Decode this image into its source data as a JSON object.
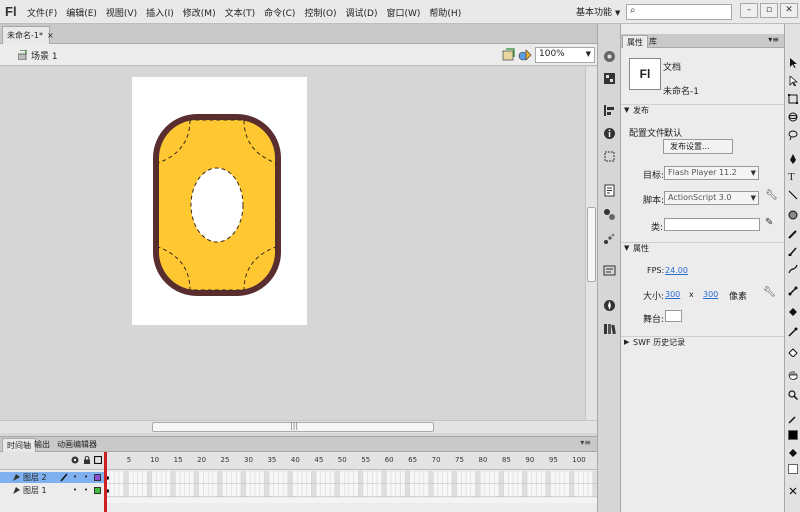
{
  "app": {
    "logo": "Fl"
  },
  "menu": [
    "文件(F)",
    "编辑(E)",
    "视图(V)",
    "插入(I)",
    "修改(M)",
    "文本(T)",
    "命令(C)",
    "控制(O)",
    "调试(D)",
    "窗口(W)",
    "帮助(H)"
  ],
  "workspace": {
    "label": "基本功能"
  },
  "window_controls": {
    "minimize": "–",
    "restore": "▫",
    "close": "✕"
  },
  "document": {
    "tab_name": "未命名-1*",
    "tab_close": "×"
  },
  "editbar": {
    "scene": "场景 1",
    "zoom": "100%"
  },
  "timeline": {
    "tabs": [
      "时间轴",
      "输出",
      "动画编辑器"
    ],
    "frame_numbers": [
      "5",
      "10",
      "15",
      "20",
      "25",
      "30",
      "35",
      "40",
      "45",
      "50",
      "55",
      "60",
      "65",
      "70",
      "75",
      "80",
      "85",
      "90",
      "95",
      "100"
    ],
    "layers": [
      {
        "name": "图层 2",
        "selected": true,
        "color": "#8a4fd6"
      },
      {
        "name": "图层 1",
        "selected": false,
        "color": "#3fbf3f"
      }
    ]
  },
  "properties": {
    "tabs": [
      "属性",
      "库"
    ],
    "doc_icon": "Fl",
    "doc_type": "文档",
    "doc_name": "未命名-1",
    "publish": {
      "header": "发布",
      "profile_label": "配置文件:",
      "profile_value": "默认",
      "settings_button": "发布设置...",
      "target_label": "目标:",
      "target_value": "Flash Player 11.2",
      "script_label": "脚本:",
      "script_value": "ActionScript 3.0",
      "class_label": "类:"
    },
    "attributes": {
      "header": "属性",
      "fps_label": "FPS:",
      "fps_value": "24.00",
      "size_label": "大小:",
      "width": "300",
      "x": "x",
      "height": "300",
      "unit": "像素",
      "stage_label": "舞台:"
    },
    "swf_history": "SWF 历史记录"
  },
  "colors": {
    "ring_fill": "#ffc832",
    "ring_outline": "#5a2e2e",
    "layer_selected_bg": "#7fb0ef"
  }
}
